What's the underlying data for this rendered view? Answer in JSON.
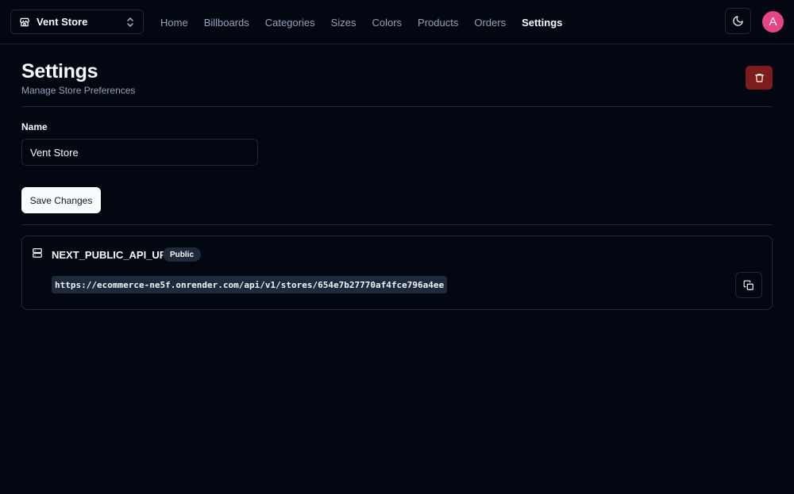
{
  "navbar": {
    "store_switcher": {
      "name": "Vent Store",
      "icon": "store-icon"
    },
    "links": [
      {
        "label": "Home",
        "active": false
      },
      {
        "label": "Billboards",
        "active": false
      },
      {
        "label": "Categories",
        "active": false
      },
      {
        "label": "Sizes",
        "active": false
      },
      {
        "label": "Colors",
        "active": false
      },
      {
        "label": "Products",
        "active": false
      },
      {
        "label": "Orders",
        "active": false
      },
      {
        "label": "Settings",
        "active": true
      }
    ],
    "theme_icon": "moon-icon",
    "avatar": {
      "initial": "A",
      "color": "#e64583"
    }
  },
  "header": {
    "title": "Settings",
    "subtitle": "Manage Store Preferences",
    "delete_icon": "trash-icon",
    "delete_color": "#7f1d1d"
  },
  "form": {
    "name_label": "Name",
    "name_value": "Vent Store",
    "save_label": "Save Changes"
  },
  "api_alert": {
    "title": "NEXT_PUBLIC_API_URL",
    "badge": "Public",
    "url": "https://ecommerce-ne5f.onrender.com/api/v1/stores/654e7b27770af4fce796a4ee",
    "icon": "server-icon",
    "copy_icon": "copy-icon"
  },
  "colors": {
    "background": "#030712",
    "border": "#1f2937",
    "muted_text": "#94a3b8"
  }
}
